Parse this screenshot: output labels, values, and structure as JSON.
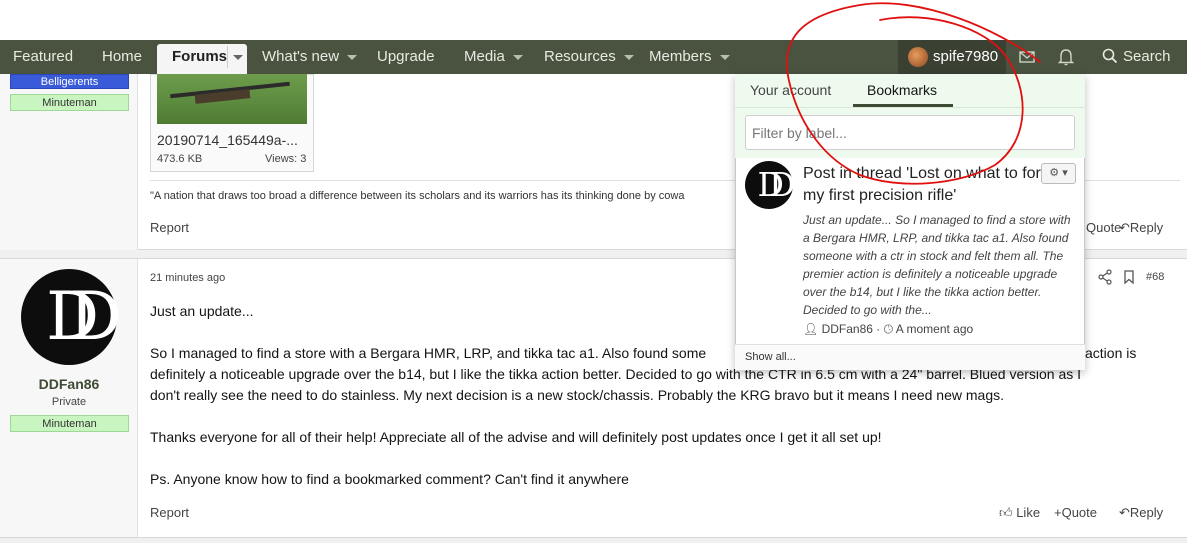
{
  "nav": {
    "items": [
      {
        "label": "Featured"
      },
      {
        "label": "Home"
      },
      {
        "label": "Forums"
      },
      {
        "label": "What's new"
      },
      {
        "label": "Upgrade"
      },
      {
        "label": "Media"
      },
      {
        "label": "Resources"
      },
      {
        "label": "Members"
      }
    ],
    "username": "spife7980",
    "search_label": "Search"
  },
  "post1": {
    "badges": [
      "Belligerents",
      "Minuteman"
    ],
    "attachment": {
      "name": "20190714_165449a-...",
      "size": "473.6 KB",
      "views": "Views: 3"
    },
    "signature": "\"A nation that draws too broad a difference between its scholars and its warriors has its thinking done by cowa",
    "report": "Report",
    "quote": "Quote",
    "reply": "Reply"
  },
  "post2": {
    "author": "DDFan86",
    "rank": "Private",
    "badge": "Minuteman",
    "time": "21 minutes ago",
    "post_number": "#68",
    "lines": [
      "Just an update...",
      "So I managed to find a store with a Bergara HMR, LRP, and tikka tac a1. Also found some",
      "action is",
      "definitely a noticeable upgrade over the b14, but I like the tikka action better. Decided to go with the CTR in 6.5 cm with a 24\" barrel. Blued version as I",
      "don't really see the need to do stainless. My next decision is a new stock/chassis. Probably the KRG bravo but it means I need new mags.",
      "Thanks everyone for all of their help! Appreciate all of the advise and will definitely post updates once I get it all set up!",
      "Ps. Anyone know how to find a bookmarked comment? Can't find it anywhere"
    ],
    "report": "Report",
    "like": "Like",
    "quote": "Quote",
    "reply": "Reply"
  },
  "popup": {
    "tabs": [
      "Your account",
      "Bookmarks"
    ],
    "filter_placeholder": "Filter by label...",
    "bookmark": {
      "title": "Post in thread 'Lost on what to for my first precision rifle'",
      "snippet": "Just an update... So I managed to find a store with a Bergara HMR, LRP, and tikka tac a1. Also found someone with a ctr in stock and felt them all. The premier action is definitely a noticeable upgrade over the b14, but I like the tikka action better. Decided to go with the...",
      "author": "DDFan86",
      "time": "A moment ago"
    },
    "show_all": "Show all..."
  },
  "colors": {
    "nav_bg": "#4a5240",
    "badge_blue": "#3a5bd9",
    "badge_green": "#c8f5c0",
    "annotation_red": "#e01010"
  },
  "icons": [
    "chevron-down-icon",
    "envelope-icon",
    "bell-icon",
    "search-icon",
    "gear-icon",
    "share-icon",
    "bookmark-icon",
    "like-icon",
    "reply-icon",
    "user-icon",
    "clock-icon"
  ]
}
